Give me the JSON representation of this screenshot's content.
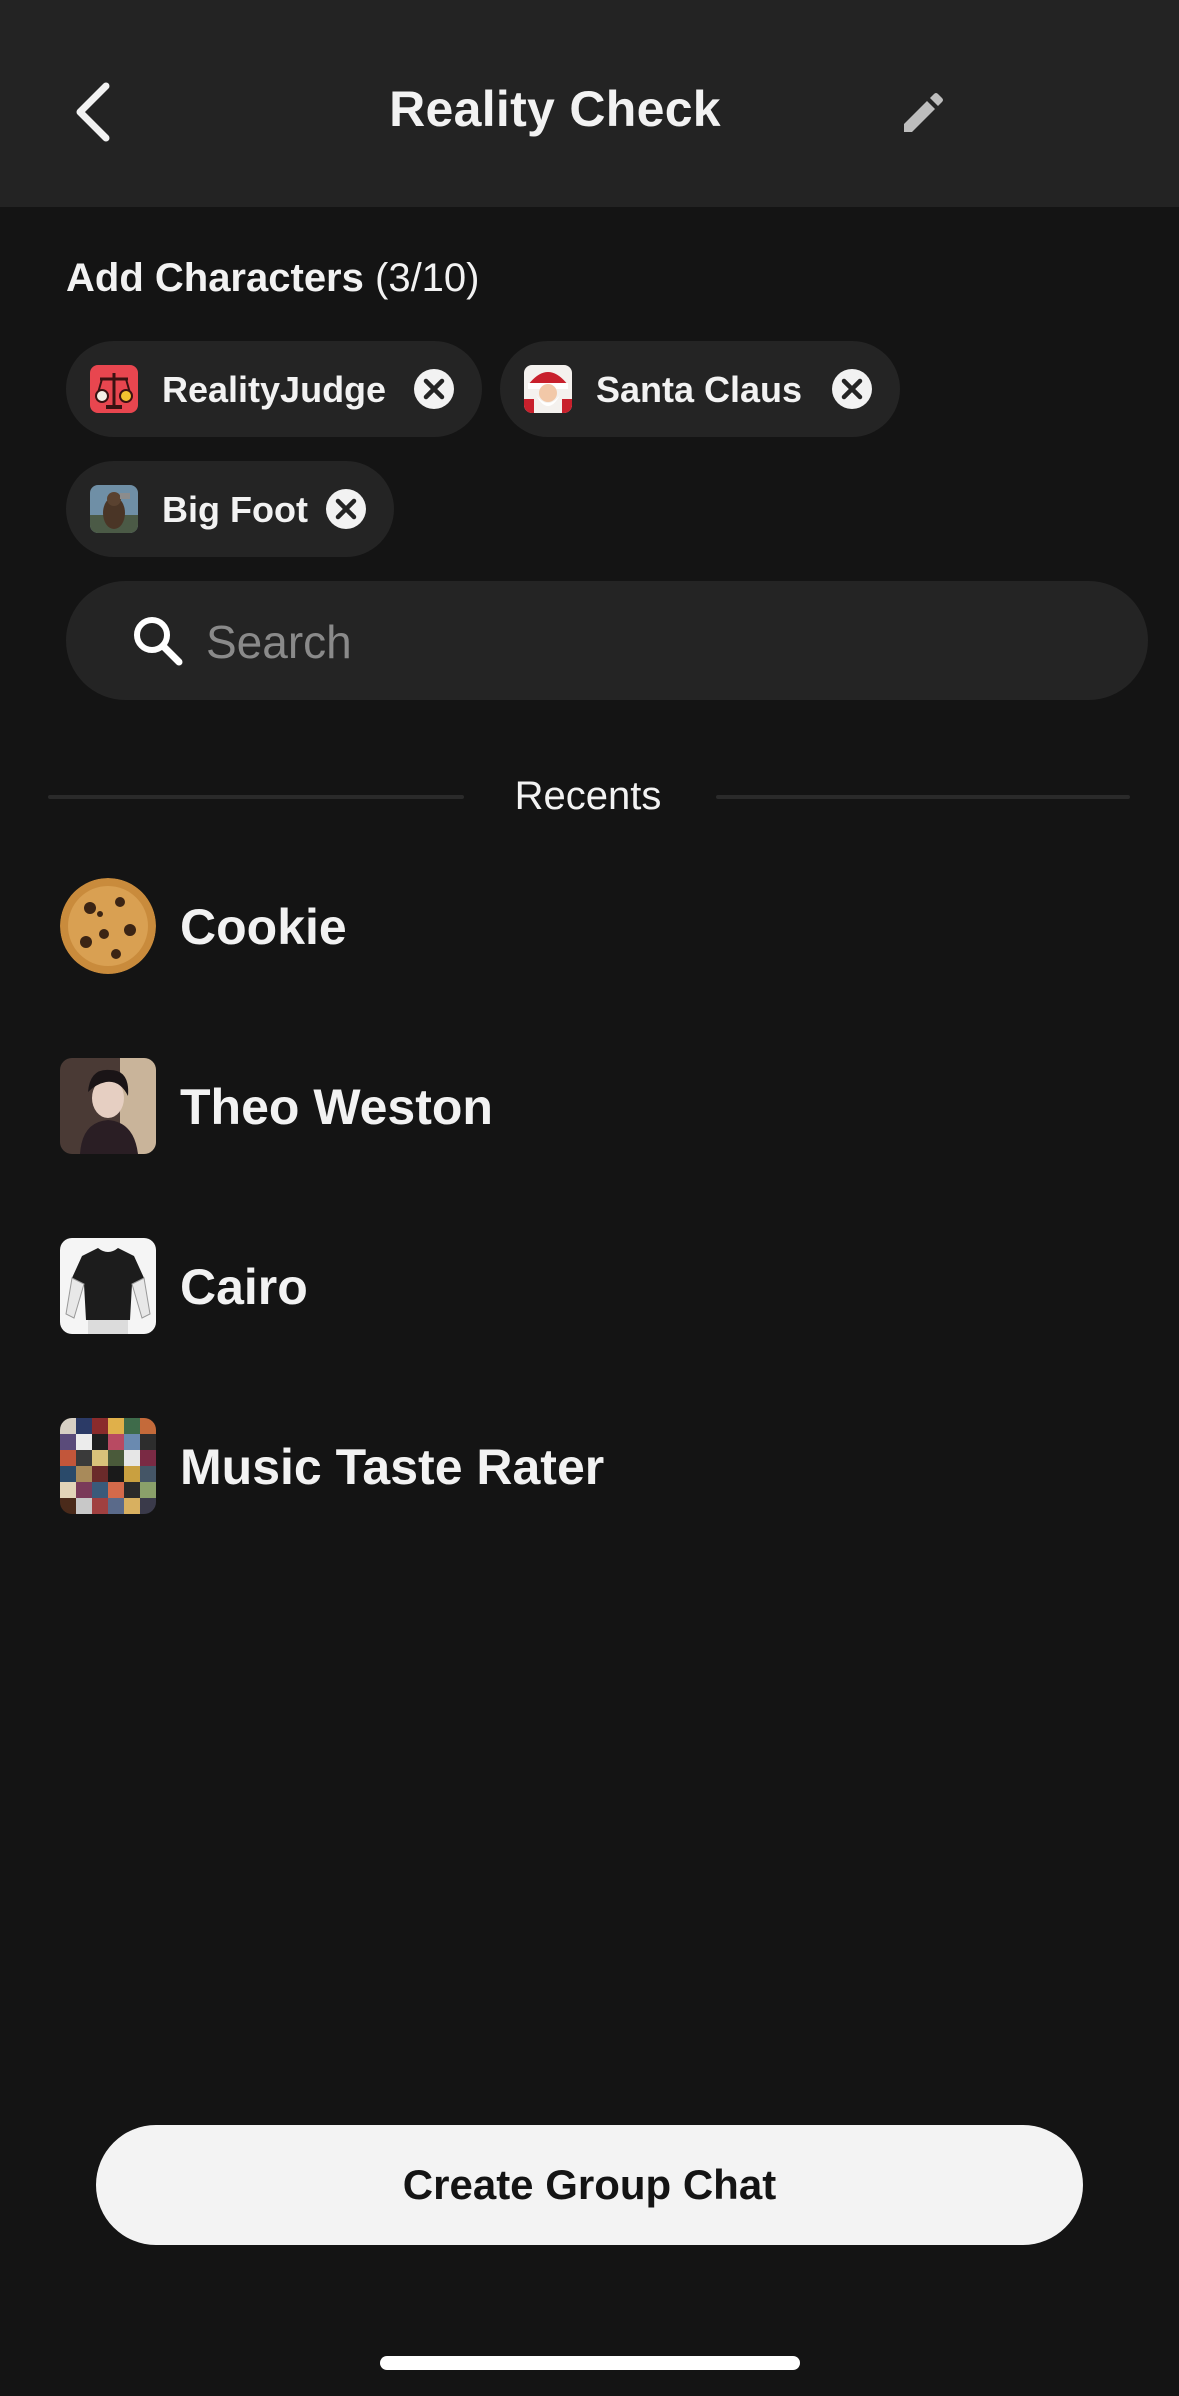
{
  "header": {
    "title": "Reality Check",
    "back_icon": "chevron-left-icon",
    "edit_icon": "pencil-icon"
  },
  "add_characters": {
    "label": "Add Characters",
    "count": "(3/10)"
  },
  "selected_characters": [
    {
      "name": "RealityJudge",
      "avatar": "scales-avatar"
    },
    {
      "name": "Santa Claus",
      "avatar": "santa-avatar"
    },
    {
      "name": "Big Foot",
      "avatar": "bigfoot-avatar"
    }
  ],
  "search": {
    "placeholder": "Search",
    "value": ""
  },
  "recents": {
    "label": "Recents",
    "items": [
      {
        "name": "Cookie",
        "avatar": "cookie-avatar"
      },
      {
        "name": "Theo Weston",
        "avatar": "portrait-avatar"
      },
      {
        "name": "Cairo",
        "avatar": "tshirt-avatar"
      },
      {
        "name": "Music Taste Rater",
        "avatar": "album-grid-avatar"
      }
    ]
  },
  "create_button": {
    "label": "Create Group Chat"
  },
  "colors": {
    "background": "#141414",
    "header": "#232323",
    "surface": "#242424",
    "text": "#f2f2f2",
    "button": "#f3f3f3"
  }
}
